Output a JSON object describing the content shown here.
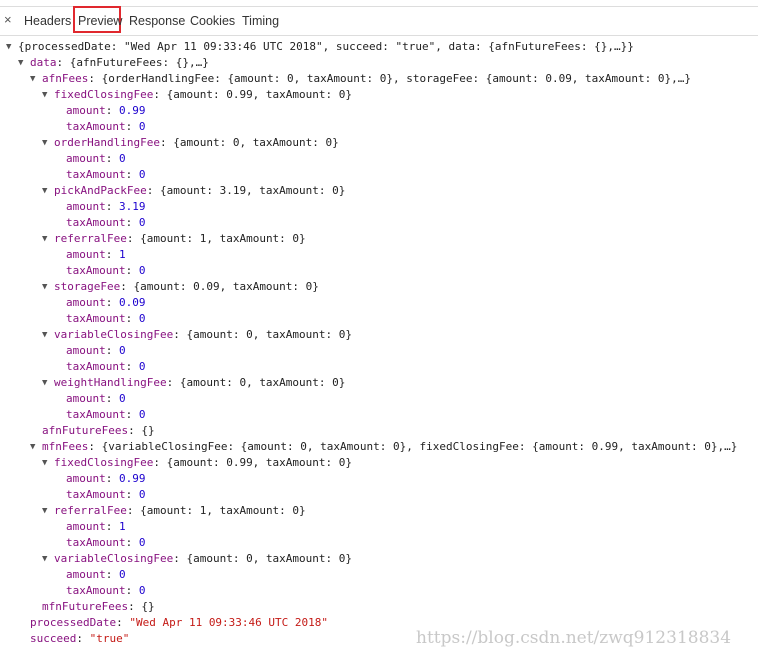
{
  "tabs": {
    "close": "×",
    "items": [
      "Headers",
      "Preview",
      "Response",
      "Cookies",
      "Timing"
    ],
    "active": "Preview"
  },
  "lines": [
    {
      "l": 0,
      "a": 1,
      "t": "{processedDate: \"Wed Apr 11 09:33:46 UTC 2018\", succeed: \"true\", data: {afnFutureFees: {},…}}"
    },
    {
      "l": 1,
      "a": 1,
      "k": "data",
      "t": "{afnFutureFees: {},…}"
    },
    {
      "l": 2,
      "a": 1,
      "k": "afnFees",
      "t": "{orderHandlingFee: {amount: 0, taxAmount: 0}, storageFee: {amount: 0.09, taxAmount: 0},…}"
    },
    {
      "l": 3,
      "a": 1,
      "k": "fixedClosingFee",
      "t": "{amount: 0.99, taxAmount: 0}"
    },
    {
      "l": 4,
      "k": "amount",
      "v": "0.99",
      "c": "num"
    },
    {
      "l": 4,
      "k": "taxAmount",
      "v": "0",
      "c": "num"
    },
    {
      "l": 3,
      "a": 1,
      "k": "orderHandlingFee",
      "t": "{amount: 0, taxAmount: 0}"
    },
    {
      "l": 4,
      "k": "amount",
      "v": "0",
      "c": "num"
    },
    {
      "l": 4,
      "k": "taxAmount",
      "v": "0",
      "c": "num"
    },
    {
      "l": 3,
      "a": 1,
      "k": "pickAndPackFee",
      "t": "{amount: 3.19, taxAmount: 0}"
    },
    {
      "l": 4,
      "k": "amount",
      "v": "3.19",
      "c": "num"
    },
    {
      "l": 4,
      "k": "taxAmount",
      "v": "0",
      "c": "num"
    },
    {
      "l": 3,
      "a": 1,
      "k": "referralFee",
      "t": "{amount: 1, taxAmount: 0}"
    },
    {
      "l": 4,
      "k": "amount",
      "v": "1",
      "c": "num"
    },
    {
      "l": 4,
      "k": "taxAmount",
      "v": "0",
      "c": "num"
    },
    {
      "l": 3,
      "a": 1,
      "k": "storageFee",
      "t": "{amount: 0.09, taxAmount: 0}"
    },
    {
      "l": 4,
      "k": "amount",
      "v": "0.09",
      "c": "num"
    },
    {
      "l": 4,
      "k": "taxAmount",
      "v": "0",
      "c": "num"
    },
    {
      "l": 3,
      "a": 1,
      "k": "variableClosingFee",
      "t": "{amount: 0, taxAmount: 0}"
    },
    {
      "l": 4,
      "k": "amount",
      "v": "0",
      "c": "num"
    },
    {
      "l": 4,
      "k": "taxAmount",
      "v": "0",
      "c": "num"
    },
    {
      "l": 3,
      "a": 1,
      "k": "weightHandlingFee",
      "t": "{amount: 0, taxAmount: 0}"
    },
    {
      "l": 4,
      "k": "amount",
      "v": "0",
      "c": "num"
    },
    {
      "l": 4,
      "k": "taxAmount",
      "v": "0",
      "c": "num"
    },
    {
      "l": 2,
      "k": "afnFutureFees",
      "t": "{}"
    },
    {
      "l": 2,
      "a": 1,
      "k": "mfnFees",
      "t": "{variableClosingFee: {amount: 0, taxAmount: 0}, fixedClosingFee: {amount: 0.99, taxAmount: 0},…}"
    },
    {
      "l": 3,
      "a": 1,
      "k": "fixedClosingFee",
      "t": "{amount: 0.99, taxAmount: 0}"
    },
    {
      "l": 4,
      "k": "amount",
      "v": "0.99",
      "c": "num"
    },
    {
      "l": 4,
      "k": "taxAmount",
      "v": "0",
      "c": "num"
    },
    {
      "l": 3,
      "a": 1,
      "k": "referralFee",
      "t": "{amount: 1, taxAmount: 0}"
    },
    {
      "l": 4,
      "k": "amount",
      "v": "1",
      "c": "num"
    },
    {
      "l": 4,
      "k": "taxAmount",
      "v": "0",
      "c": "num"
    },
    {
      "l": 3,
      "a": 1,
      "k": "variableClosingFee",
      "t": "{amount: 0, taxAmount: 0}"
    },
    {
      "l": 4,
      "k": "amount",
      "v": "0",
      "c": "num"
    },
    {
      "l": 4,
      "k": "taxAmount",
      "v": "0",
      "c": "num"
    },
    {
      "l": 2,
      "k": "mfnFutureFees",
      "t": "{}"
    },
    {
      "l": 1,
      "k": "processedDate",
      "v": "\"Wed Apr 11 09:33:46 UTC 2018\"",
      "c": "str"
    },
    {
      "l": 1,
      "k": "succeed",
      "v": "\"true\"",
      "c": "str"
    }
  ],
  "watermark": "https://blog.csdn.net/zwq912318834"
}
